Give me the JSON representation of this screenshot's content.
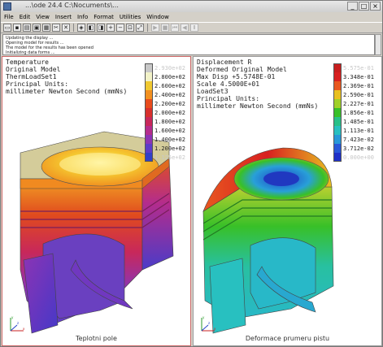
{
  "window": {
    "title": "...\\ode 24.4 C:\\Nocuments\\..."
  },
  "menu": [
    "File",
    "Edit",
    "View",
    "Insert",
    "Info",
    "Format",
    "Utilities",
    "Window"
  ],
  "toolbar": {
    "icons": [
      "open-icon",
      "save-icon",
      "print-icon",
      "copy-icon",
      "paste-icon",
      "cut-icon",
      "close-icon",
      "animate-icon",
      "frames-icon",
      "frames-back-icon",
      "zoom-in-icon",
      "zoom-out-icon",
      "zoom-box-icon",
      "refit-icon",
      "play-icon",
      "stop-icon",
      "rewind-icon",
      "step-back-icon",
      "pause-icon"
    ]
  },
  "messages": [
    "Updating the display ...",
    "Opening model for results ...",
    "The model for the results has been opened",
    "Initializing data forms ..."
  ],
  "left_view": {
    "info": [
      "Temperature",
      "Original Model",
      "ThermLoadSet1",
      "Principal Units:",
      "millimeter Newton Second (mmNs)"
    ],
    "legend": [
      {
        "label": "2.930e+02",
        "color": "#c8c8c8",
        "faint": true
      },
      {
        "label": "2.800e+02",
        "color": "#f2f2c8",
        "faint": false
      },
      {
        "label": "2.600e+02",
        "color": "#f0c830",
        "faint": false
      },
      {
        "label": "2.400e+02",
        "color": "#f29020",
        "faint": false
      },
      {
        "label": "2.200e+02",
        "color": "#e84c1c",
        "faint": false
      },
      {
        "label": "2.000e+02",
        "color": "#d8302c",
        "faint": false
      },
      {
        "label": "1.800e+02",
        "color": "#c8285a",
        "faint": false
      },
      {
        "label": "1.600e+02",
        "color": "#b42c8c",
        "faint": false
      },
      {
        "label": "1.400e+02",
        "color": "#8c34b4",
        "faint": false
      },
      {
        "label": "1.200e+02",
        "color": "#5c3cc8",
        "faint": false
      },
      {
        "label": "1.125e+02",
        "color": "#3040c8",
        "faint": true
      }
    ],
    "caption": "Teplotni pole"
  },
  "right_view": {
    "info": [
      "Displacement R",
      "Deformed Original Model",
      "Max Disp +5.5748E-01",
      "Scale 4.5000E+01",
      "LoadSet3",
      "Principal Units:",
      "millimeter Newton Second (mmNs)"
    ],
    "legend": [
      {
        "label": "5.575e-01",
        "color": "#c81e1e",
        "faint": true
      },
      {
        "label": "3.348e-01",
        "color": "#d82020",
        "faint": false
      },
      {
        "label": "2.369e-01",
        "color": "#e85820",
        "faint": false
      },
      {
        "label": "2.590e-01",
        "color": "#e8c020",
        "faint": false
      },
      {
        "label": "2.227e-01",
        "color": "#a0d028",
        "faint": false
      },
      {
        "label": "1.856e-01",
        "color": "#38c028",
        "faint": false
      },
      {
        "label": "1.485e-01",
        "color": "#28c088",
        "faint": false
      },
      {
        "label": "1.113e-01",
        "color": "#28c0c0",
        "faint": false
      },
      {
        "label": "7.423e-02",
        "color": "#2898d8",
        "faint": false
      },
      {
        "label": "3.712e-02",
        "color": "#2858d8",
        "faint": false
      },
      {
        "label": "0.000e+00",
        "color": "#1e30c8",
        "faint": true
      }
    ],
    "caption": "Deformace prumeru pistu"
  },
  "axes_labels": {
    "x": "x",
    "y": "y",
    "z": "z"
  }
}
